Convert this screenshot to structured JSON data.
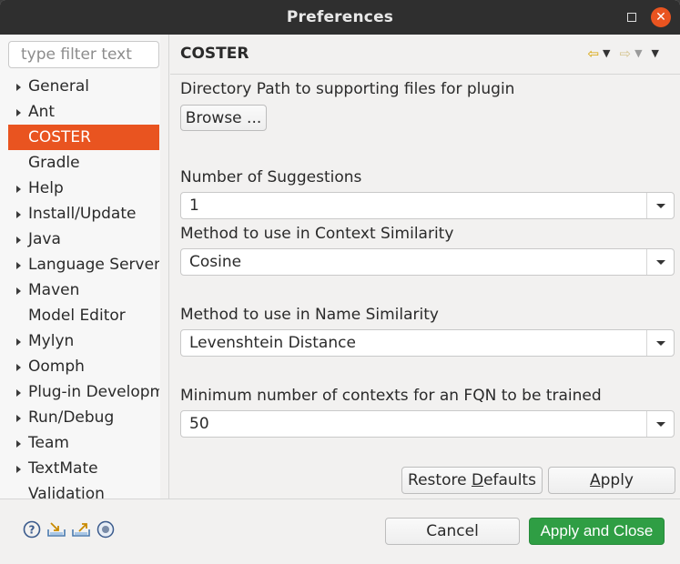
{
  "window": {
    "title": "Preferences"
  },
  "filter": {
    "placeholder": "type filter text"
  },
  "tree": [
    {
      "label": "General",
      "expandable": true
    },
    {
      "label": "Ant",
      "expandable": true
    },
    {
      "label": "COSTER",
      "expandable": false,
      "selected": true
    },
    {
      "label": "Gradle",
      "expandable": false
    },
    {
      "label": "Help",
      "expandable": true
    },
    {
      "label": "Install/Update",
      "expandable": true
    },
    {
      "label": "Java",
      "expandable": true
    },
    {
      "label": "Language Servers",
      "expandable": true
    },
    {
      "label": "Maven",
      "expandable": true
    },
    {
      "label": "Model Editor",
      "expandable": false
    },
    {
      "label": "Mylyn",
      "expandable": true
    },
    {
      "label": "Oomph",
      "expandable": true
    },
    {
      "label": "Plug-in Development",
      "expandable": true
    },
    {
      "label": "Run/Debug",
      "expandable": true
    },
    {
      "label": "Team",
      "expandable": true
    },
    {
      "label": "TextMate",
      "expandable": true
    },
    {
      "label": "Validation",
      "expandable": false
    }
  ],
  "page": {
    "title": "COSTER",
    "dir_label": "Directory Path to supporting files for plugin",
    "browse_label": "Browse ...",
    "suggestions_label": "Number of Suggestions",
    "suggestions_value": "1",
    "context_label": "Method to use in Context Similarity",
    "context_value": "Cosine",
    "name_label": "Method to use in Name Similarity",
    "name_value": "Levenshtein Distance",
    "min_label": "Minimum number of contexts for an FQN to be trained",
    "min_value": "50",
    "restore_pre": "Restore ",
    "restore_u": "D",
    "restore_post": "efaults",
    "apply_u": "A",
    "apply_post": "pply"
  },
  "footer": {
    "cancel_label": "Cancel",
    "apply_close_label": "Apply and Close"
  },
  "colors": {
    "accent": "#e95420",
    "primary": "#2f9e44",
    "titlebar": "#2f2f2f"
  }
}
